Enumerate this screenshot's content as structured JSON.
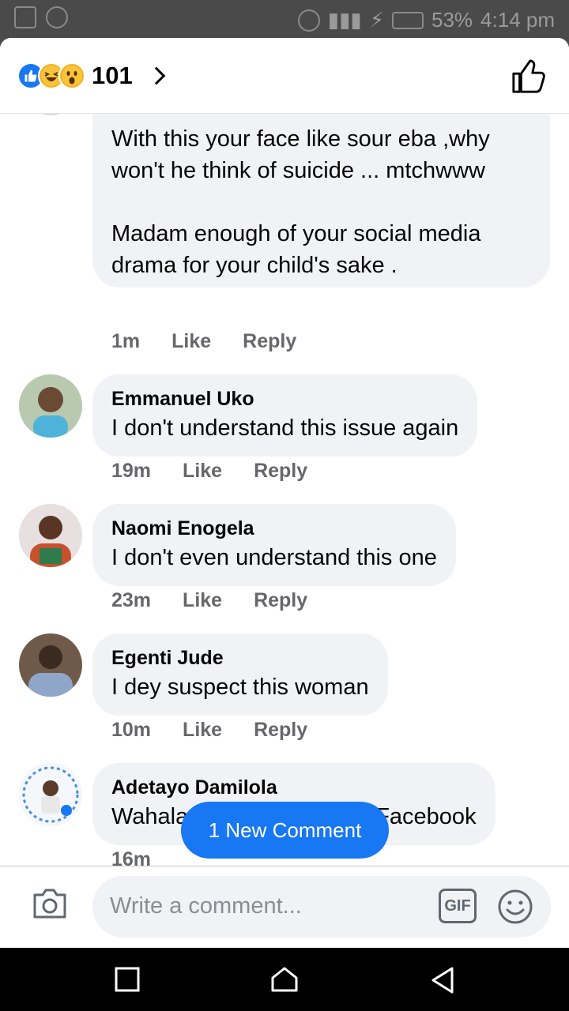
{
  "status_bar": {
    "battery": "53%",
    "time": "4:14 pm"
  },
  "header": {
    "reaction_count": "101"
  },
  "comments": [
    {
      "name": "",
      "text": "With this your face like sour eba ,why won't he think of suicide ... mtchwww\n\nMadam enough of your social media drama for your child's sake .",
      "time": "1m",
      "like": "Like",
      "reply": "Reply"
    },
    {
      "name": "Emmanuel Uko",
      "text": "I don't understand this issue again",
      "time": "19m",
      "like": "Like",
      "reply": "Reply"
    },
    {
      "name": "Naomi Enogela",
      "text": "I don't even understand this one",
      "time": "23m",
      "like": "Like",
      "reply": "Reply"
    },
    {
      "name": "Egenti Jude",
      "text": "I dey suspect this woman",
      "time": "10m",
      "like": "Like",
      "reply": "Reply"
    },
    {
      "name": "Adetayo Damilola",
      "text": "Wahala  no dey finish  for Facebook",
      "time": "16m",
      "like": "",
      "reply": ""
    }
  ],
  "new_comment_pill": "1 New Comment",
  "composer": {
    "placeholder": "Write a comment...",
    "gif_label": "GIF"
  },
  "colors": {
    "accent": "#1877f2",
    "bubble": "#f0f2f5",
    "meta": "#65676b"
  }
}
